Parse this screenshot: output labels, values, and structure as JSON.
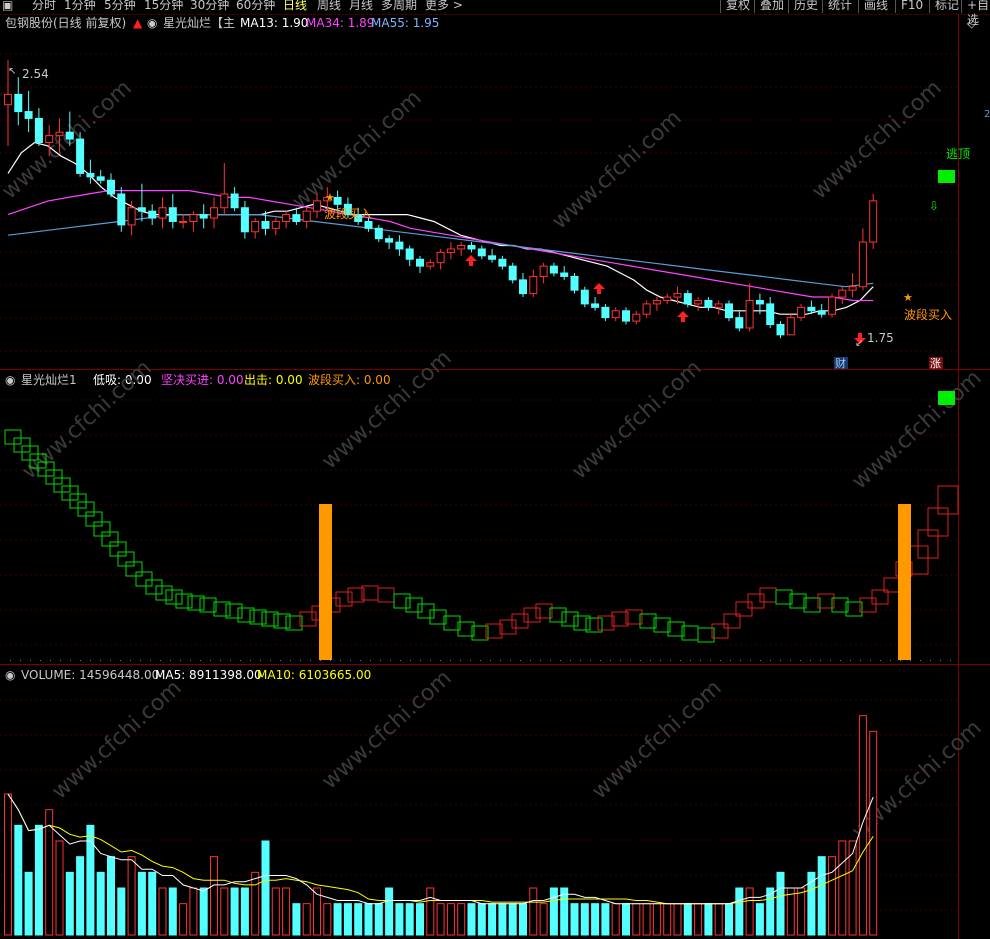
{
  "toolbar": {
    "menu_icon": "window-icon",
    "periods": [
      "分时",
      "1分钟",
      "5分钟",
      "15分钟",
      "30分钟",
      "60分钟",
      "日线",
      "周线",
      "月线",
      "多周期",
      "更多 >"
    ],
    "active_period": "日线",
    "right_buttons": [
      "复权",
      "叠加",
      "历史",
      "统计",
      "画线",
      "F10",
      "标记",
      "+自选"
    ]
  },
  "main_pane": {
    "stock": "包钢股份(日线 前复权)",
    "indicator_name": "星光灿烂【主",
    "ma13_label": "MA13: 1.90",
    "ma34_label": "MA34: 1.89",
    "ma55_label": "MA55: 1.95",
    "high_label": "2.54",
    "low_label": "1.75",
    "signal_label_1": "波段买入",
    "signal_label_2": "波段买入",
    "escape_label": "逃顶",
    "tag_cai": "财",
    "tag_zhang": "涨",
    "edge_label": "2"
  },
  "indicator_pane": {
    "name": "星光灿烂1",
    "dixi": "低吸: 0.00",
    "jianjue": "坚决买进: 0.00",
    "chuji": "出击: 0.00",
    "boduan": "波段买入: 0.00"
  },
  "volume_pane": {
    "volume": "VOLUME: 14596448.00",
    "ma5": "MA5: 8911398.00",
    "ma10": "MA10: 6103665.00"
  },
  "watermark": "www.cfchi.com",
  "colors": {
    "up": "#ff3232",
    "down": "#54ffff",
    "ma13": "#ffffff",
    "ma34": "#ff44ff",
    "ma55": "#5b9bd5",
    "orange": "#ff9900",
    "green_box": "#00ee00",
    "vol_ma5": "#ffffff",
    "vol_ma10": "#ffff00"
  },
  "chart_data": {
    "type": "candlestick",
    "price_range": [
      1.7,
      2.62
    ],
    "candles": [
      [
        2.42,
        2.55,
        2.3,
        2.45
      ],
      [
        2.45,
        2.5,
        2.36,
        2.4
      ],
      [
        2.4,
        2.46,
        2.34,
        2.38
      ],
      [
        2.38,
        2.41,
        2.3,
        2.31
      ],
      [
        2.31,
        2.36,
        2.27,
        2.33
      ],
      [
        2.33,
        2.38,
        2.28,
        2.34
      ],
      [
        2.34,
        2.4,
        2.3,
        2.32
      ],
      [
        2.32,
        2.34,
        2.21,
        2.22
      ],
      [
        2.22,
        2.26,
        2.19,
        2.21
      ],
      [
        2.21,
        2.23,
        2.19,
        2.2
      ],
      [
        2.2,
        2.22,
        2.15,
        2.16
      ],
      [
        2.16,
        2.18,
        2.05,
        2.07
      ],
      [
        2.07,
        2.14,
        2.04,
        2.12
      ],
      [
        2.12,
        2.19,
        2.08,
        2.11
      ],
      [
        2.11,
        2.13,
        2.07,
        2.09
      ],
      [
        2.09,
        2.15,
        2.06,
        2.12
      ],
      [
        2.12,
        2.16,
        2.06,
        2.08
      ],
      [
        2.08,
        2.1,
        2.06,
        2.08
      ],
      [
        2.08,
        2.11,
        2.05,
        2.1
      ],
      [
        2.1,
        2.13,
        2.06,
        2.09
      ],
      [
        2.09,
        2.15,
        2.06,
        2.12
      ],
      [
        2.12,
        2.25,
        2.1,
        2.16
      ],
      [
        2.16,
        2.18,
        2.11,
        2.12
      ],
      [
        2.12,
        2.14,
        2.03,
        2.05
      ],
      [
        2.05,
        2.09,
        2.03,
        2.08
      ],
      [
        2.08,
        2.11,
        2.04,
        2.06
      ],
      [
        2.06,
        2.09,
        2.04,
        2.08
      ],
      [
        2.08,
        2.11,
        2.06,
        2.1
      ],
      [
        2.1,
        2.12,
        2.07,
        2.08
      ],
      [
        2.08,
        2.12,
        2.06,
        2.11
      ],
      [
        2.11,
        2.16,
        2.09,
        2.14
      ],
      [
        2.14,
        2.18,
        2.11,
        2.15
      ],
      [
        2.15,
        2.17,
        2.11,
        2.13
      ],
      [
        2.13,
        2.15,
        2.09,
        2.1
      ],
      [
        2.1,
        2.12,
        2.07,
        2.08
      ],
      [
        2.08,
        2.09,
        2.05,
        2.06
      ],
      [
        2.06,
        2.07,
        2.02,
        2.03
      ],
      [
        2.03,
        2.04,
        2.0,
        2.02
      ],
      [
        2.02,
        2.04,
        1.98,
        2.0
      ],
      [
        2.0,
        2.01,
        1.95,
        1.97
      ],
      [
        1.97,
        1.98,
        1.93,
        1.95
      ],
      [
        1.95,
        1.97,
        1.94,
        1.96
      ],
      [
        1.96,
        2.0,
        1.94,
        1.99
      ],
      [
        1.99,
        2.02,
        1.97,
        2.0
      ],
      [
        2.0,
        2.02,
        1.98,
        2.01
      ],
      [
        2.01,
        2.02,
        1.99,
        2.0
      ],
      [
        2.0,
        2.01,
        1.97,
        1.98
      ],
      [
        1.98,
        2.0,
        1.96,
        1.97
      ],
      [
        1.97,
        1.98,
        1.94,
        1.95
      ],
      [
        1.95,
        1.96,
        1.9,
        1.91
      ],
      [
        1.91,
        1.93,
        1.86,
        1.87
      ],
      [
        1.87,
        1.94,
        1.86,
        1.92
      ],
      [
        1.92,
        1.96,
        1.9,
        1.95
      ],
      [
        1.95,
        1.96,
        1.92,
        1.93
      ],
      [
        1.93,
        1.95,
        1.91,
        1.92
      ],
      [
        1.92,
        1.93,
        1.87,
        1.88
      ],
      [
        1.88,
        1.89,
        1.83,
        1.84
      ],
      [
        1.84,
        1.86,
        1.82,
        1.83
      ],
      [
        1.83,
        1.84,
        1.79,
        1.8
      ],
      [
        1.8,
        1.83,
        1.79,
        1.82
      ],
      [
        1.82,
        1.83,
        1.78,
        1.79
      ],
      [
        1.79,
        1.82,
        1.78,
        1.81
      ],
      [
        1.81,
        1.85,
        1.8,
        1.84
      ],
      [
        1.84,
        1.86,
        1.82,
        1.85
      ],
      [
        1.85,
        1.87,
        1.84,
        1.86
      ],
      [
        1.86,
        1.89,
        1.84,
        1.87
      ],
      [
        1.87,
        1.88,
        1.83,
        1.84
      ],
      [
        1.84,
        1.86,
        1.82,
        1.85
      ],
      [
        1.85,
        1.86,
        1.82,
        1.83
      ],
      [
        1.83,
        1.85,
        1.81,
        1.84
      ],
      [
        1.84,
        1.85,
        1.79,
        1.8
      ],
      [
        1.8,
        1.82,
        1.76,
        1.77
      ],
      [
        1.77,
        1.9,
        1.76,
        1.85
      ],
      [
        1.85,
        1.87,
        1.81,
        1.84
      ],
      [
        1.84,
        1.86,
        1.77,
        1.78
      ],
      [
        1.78,
        1.79,
        1.74,
        1.75
      ],
      [
        1.75,
        1.81,
        1.75,
        1.8
      ],
      [
        1.8,
        1.84,
        1.79,
        1.83
      ],
      [
        1.83,
        1.85,
        1.81,
        1.82
      ],
      [
        1.82,
        1.84,
        1.8,
        1.81
      ],
      [
        1.81,
        1.87,
        1.8,
        1.86
      ],
      [
        1.86,
        1.89,
        1.84,
        1.88
      ],
      [
        1.88,
        1.93,
        1.86,
        1.89
      ],
      [
        1.89,
        2.06,
        1.88,
        2.02
      ],
      [
        2.02,
        2.16,
        2.0,
        2.14
      ]
    ],
    "ma13_points": [
      2.22,
      2.28,
      2.31,
      2.3,
      2.27,
      2.25,
      2.22,
      2.18,
      2.15,
      2.13,
      2.11,
      2.1,
      2.1,
      2.1,
      2.1,
      2.1,
      2.1,
      2.1,
      2.1,
      2.1,
      2.11,
      2.11,
      2.12,
      2.13,
      2.12,
      2.11,
      2.1,
      2.1,
      2.1,
      2.1,
      2.1,
      2.09,
      2.08,
      2.06,
      2.04,
      2.03,
      2.02,
      2.01,
      2.01,
      2.0,
      2.0,
      1.99,
      1.98,
      1.97,
      1.96,
      1.95,
      1.93,
      1.91,
      1.88,
      1.86,
      1.85,
      1.84,
      1.83,
      1.83,
      1.82,
      1.82,
      1.82,
      1.82,
      1.81,
      1.81,
      1.81,
      1.82,
      1.82,
      1.83,
      1.85,
      1.89
    ],
    "ma34_points": [
      2.1,
      2.12,
      2.14,
      2.15,
      2.16,
      2.17,
      2.17,
      2.17,
      2.17,
      2.17,
      2.16,
      2.15,
      2.15,
      2.14,
      2.13,
      2.12,
      2.11,
      2.1,
      2.09,
      2.08,
      2.06,
      2.05,
      2.04,
      2.03,
      2.02,
      2.01,
      2.0,
      1.99,
      1.98,
      1.97,
      1.96,
      1.95,
      1.94,
      1.93,
      1.92,
      1.91,
      1.9,
      1.89,
      1.88,
      1.87,
      1.86,
      1.86,
      1.85,
      1.85
    ],
    "ma55_points": [
      2.04,
      2.05,
      2.06,
      2.07,
      2.08,
      2.09,
      2.1,
      2.1,
      2.1,
      2.1,
      2.09,
      2.08,
      2.07,
      2.06,
      2.05,
      2.04,
      2.03,
      2.02,
      2.01,
      2.0,
      1.99,
      1.98,
      1.97,
      1.96,
      1.95,
      1.94,
      1.93,
      1.92,
      1.91,
      1.9,
      1.89,
      1.9
    ],
    "volume_bars": [
      9,
      7,
      4,
      7,
      8,
      6,
      4,
      5,
      7,
      4,
      5,
      3,
      5,
      4,
      4,
      3,
      3,
      2,
      3,
      3,
      5,
      3,
      3,
      3,
      4,
      6,
      3,
      3,
      2,
      2,
      3,
      2,
      2,
      2,
      2,
      2,
      2,
      3,
      2,
      2,
      2,
      3,
      2,
      2,
      2,
      2,
      2,
      2,
      2,
      2,
      2,
      3,
      2,
      3,
      3,
      2,
      2,
      2,
      2,
      2,
      2,
      2,
      2,
      2,
      2,
      2,
      2,
      2,
      2,
      2,
      2,
      3,
      3,
      2,
      3,
      4,
      3,
      3,
      4,
      5,
      5,
      6,
      6,
      14,
      13
    ],
    "volume_range": [
      0,
      15
    ],
    "volume_unit": "×10^6"
  }
}
